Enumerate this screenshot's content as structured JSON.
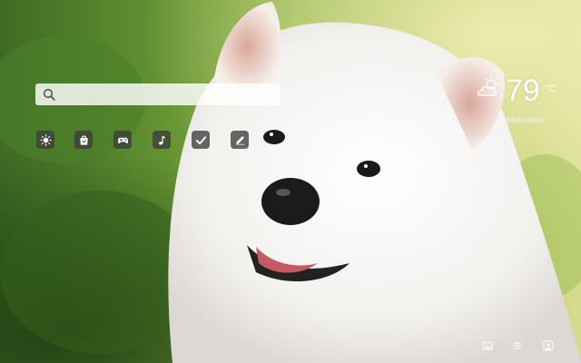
{
  "search": {
    "placeholder": "",
    "value": ""
  },
  "apps": [
    {
      "icon": "sun-icon"
    },
    {
      "icon": "shopping-bag-icon"
    },
    {
      "icon": "gamepad-icon"
    },
    {
      "icon": "music-note-icon"
    },
    {
      "icon": "checkmark-icon"
    },
    {
      "icon": "pencil-icon"
    }
  ],
  "weather": {
    "icon": "partly-cloudy-icon",
    "temperature": "79",
    "unit": "°C",
    "location": "Manhattan"
  },
  "bottom_bar": [
    {
      "icon": "image-icon"
    },
    {
      "icon": "menu-icon"
    },
    {
      "icon": "user-icon"
    }
  ]
}
